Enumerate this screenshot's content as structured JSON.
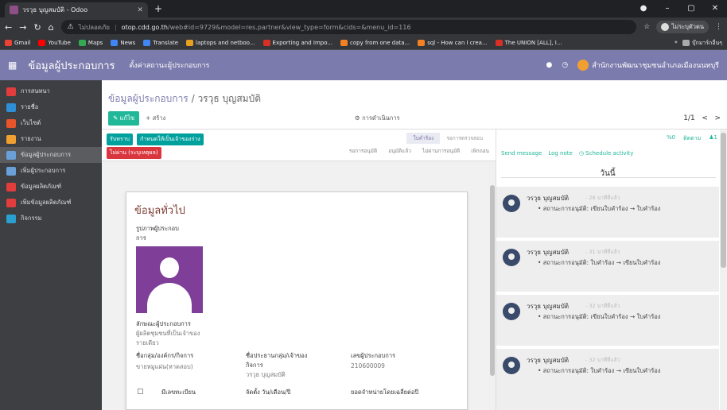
{
  "browser": {
    "tab_title": "วรวุธ บุญสมบัติ - Odoo",
    "address_warn": "ไม่ปลอดภัย",
    "url_host": "otop.cdd.go.th",
    "url_path": "/web#id=9729&model=res.partner&view_type=form&cids=&menu_id=116",
    "profile_label": "ไม่ระบุตัวตน",
    "bookmarks": [
      "Gmail",
      "YouTube",
      "Maps",
      "News",
      "Translate",
      "laptops and netboo...",
      "Exporting and Impo...",
      "copy from one data...",
      "sql - How can I crea...",
      "The UNION [ALL], I..."
    ],
    "bookmark_other": "บุ๊กมาร์กอื่นๆ"
  },
  "navbar": {
    "brand": "ข้อมูลผู้ประกอบการ",
    "menu": "ตั้งค่าสถานะผู้ประกอบการ",
    "user": "สำนักงานพัฒนาชุมชนอำเภอเมืองนนทบุรี"
  },
  "sidebar": {
    "items": [
      {
        "label": "การสนทนา",
        "color": "#e23d3d"
      },
      {
        "label": "รายชื่อ",
        "color": "#2f8fd6"
      },
      {
        "label": "เว็บไซต์",
        "color": "#e8552a"
      },
      {
        "label": "รายงาน",
        "color": "#f0a030"
      },
      {
        "label": "ข้อมูลผู้ประกอบการ",
        "color": "#6aa0d8"
      },
      {
        "label": "เพิ่มผู้ประกอบการ",
        "color": "#6aa0d8"
      },
      {
        "label": "ข้อมูลผลิตภัณฑ์",
        "color": "#e23d3d"
      },
      {
        "label": "เพิ่มข้อมูลผลิตภัณฑ์",
        "color": "#e23d3d"
      },
      {
        "label": "กิจกรรม",
        "color": "#2aa0d0"
      }
    ]
  },
  "control": {
    "breadcrumb_parent": "ข้อมูลผู้ประกอบการ",
    "breadcrumb_sep": " / ",
    "breadcrumb_current": "วรวุธ บุญสมบัติ",
    "edit_label": "✎ แก้ไข",
    "create_label": "+ สร้าง",
    "actions_label": "⚙ การดำเนินการ",
    "pager": "1/1",
    "pager_prev": "<",
    "pager_next": ">"
  },
  "statusbar": {
    "btn_accept": "รับทราบ",
    "btn_return": "กำหนดให้เป็นเจ้าของร่าง",
    "btn_reject": "ไม่ผ่าน (ระบุเหตุผล)",
    "stages": [
      "ใบคำร้อง",
      "รอการตรวจสอบ"
    ],
    "tabs": [
      "รอการอนุมัติ",
      "อนุมัติแล้ว",
      "ไม่ผ่านการอนุมัติ",
      "เพิกถอน"
    ]
  },
  "form": {
    "title": "ข้อมูลทั่วไป",
    "photo_label_1": "รูปภาพผู้ประกอบ",
    "photo_label_2": "การ",
    "type_label": "ลักษณะผู้ประกอบการ",
    "type_value_1": "ผู้ผลิตชุมชนที่เป็นเจ้าของ",
    "type_value_2": "รายเดียว",
    "shop_label": "ชื่อกลุ่ม/องค์กร/กิจการ",
    "shop_value": "ขายหมูแผ่น(หาดสอบ)",
    "owner_label_1": "ชื่อประธานกลุ่ม/เจ้าของ",
    "owner_label_2": "กิจการ",
    "owner_value": "วรวุธ บุญสมบัติ",
    "reg_label": "เลขผู้ประกอบการ",
    "reg_value": "210600009",
    "has_reg_label": "มีเลขทะเบียน",
    "date_label": "จัดตั้ง วัน/เดือน/ปี",
    "sales_label": "ยอดจำหน่ายโดยเฉลี่ยต่อปี"
  },
  "chatter": {
    "send_message": "Send message",
    "log_note": "Log note",
    "schedule": "◷ Schedule activity",
    "attach": "%0",
    "follow": "ติดตาม",
    "followers": "♟1",
    "day": "วันนี้",
    "messages": [
      {
        "author": "วรวุธ บุญสมบัติ",
        "time": "- 28 นาทีที่แล้ว",
        "body": "• สถานะการอนุมัติ: เขียนใบคำร้อง → ใบคำร้อง"
      },
      {
        "author": "วรวุธ บุญสมบัติ",
        "time": "- 31 นาทีที่แล้ว",
        "body": "• สถานะการอนุมัติ: ใบคำร้อง → เขียนใบคำร้อง"
      },
      {
        "author": "วรวุธ บุญสมบัติ",
        "time": "- 32 นาทีที่แล้ว",
        "body": "• สถานะการอนุมัติ: เขียนใบคำร้อง → ใบคำร้อง"
      },
      {
        "author": "วรวุธ บุญสมบัติ",
        "time": "- 32 นาทีที่แล้ว",
        "body": "• สถานะการอนุมัติ: ใบคำร้อง → เขียนใบคำร้อง"
      }
    ]
  }
}
